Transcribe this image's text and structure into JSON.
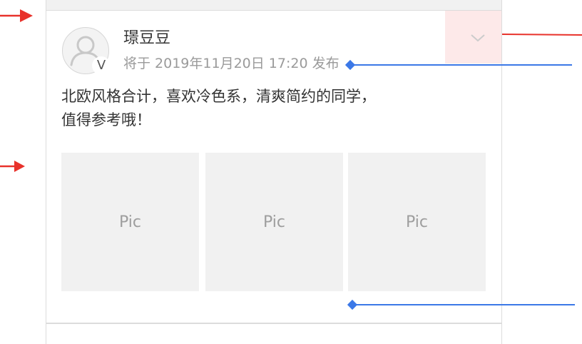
{
  "post": {
    "username": "璟豆豆",
    "verified_badge": "V",
    "timestamp": "将于 2019年11月20日 17:20 发布",
    "text_line1": "北欧风格合计，喜欢冷色系，清爽简约的同学，",
    "text_line2": "值得参考哦！",
    "pictures": [
      {
        "label": "Pic"
      },
      {
        "label": "Pic"
      },
      {
        "label": "Pic"
      }
    ]
  },
  "icons": {
    "menu": "chevron-down-icon",
    "avatar": "user-icon"
  },
  "colors": {
    "annotation_red": "#e8322b",
    "annotation_blue": "#3b78e7",
    "menu_highlight": "#fde9e9",
    "placeholder_bg": "#f1f1f1"
  }
}
